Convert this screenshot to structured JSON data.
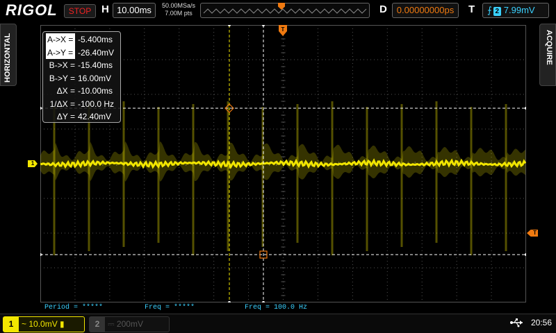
{
  "colors": {
    "ch1": "#f2e600",
    "accent_orange": "#f07a10",
    "trigger_blue": "#3ad1ff",
    "grid": "#555555",
    "cursor_white": "#ffffff"
  },
  "header": {
    "logo": "RIGOL",
    "run_state": "STOP",
    "horizontal_label": "H",
    "timebase": "10.00ms",
    "sample_rate": "50.00MSa/s",
    "memory_depth": "7.00M pts",
    "delay_label": "D",
    "delay_value": "0.00000000ps",
    "trigger_label": "T",
    "trigger_source": "2",
    "trigger_level": "7.99mV"
  },
  "side": {
    "left_tab": "HORIZONTAL",
    "right_tab": "ACQUIRE"
  },
  "markers": {
    "ch1": "1",
    "trigger_level": "T",
    "trigger_position": "T"
  },
  "cursors": {
    "rows": [
      {
        "key": "A->X =",
        "value": "-5.400ms",
        "highlight": true
      },
      {
        "key": "A->Y =",
        "value": "-26.40mV",
        "highlight": true
      },
      {
        "key": "B->X =",
        "value": "-15.40ms",
        "highlight": false
      },
      {
        "key": "B->Y =",
        "value": "16.00mV",
        "highlight": false
      },
      {
        "key": "ΔX =",
        "value": "-10.00ms",
        "highlight": false
      },
      {
        "key": "1/ΔX =",
        "value": "-100.0 Hz",
        "highlight": false
      },
      {
        "key": "ΔY =",
        "value": "42.40mV",
        "highlight": false
      }
    ]
  },
  "measurements": [
    {
      "text": "Period = *****"
    },
    {
      "text": "Freq = *****"
    },
    {
      "text": "Freq = 100.0 Hz"
    }
  ],
  "footer": {
    "ch1_number": "1",
    "ch1_scale": "~ 10.0mV",
    "ch2_number": "2",
    "ch2_scale": "200mV",
    "time": "20:56"
  }
}
